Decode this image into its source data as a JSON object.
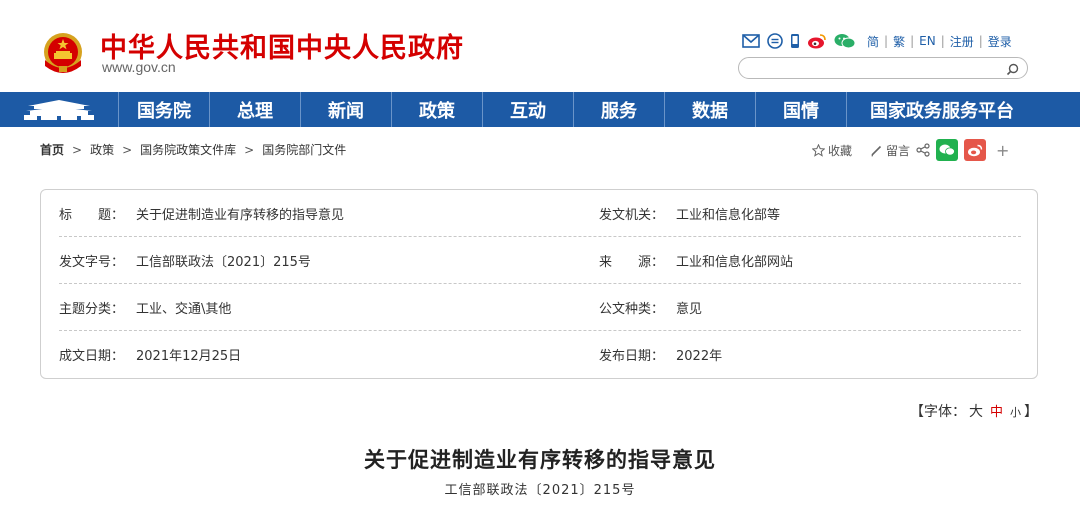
{
  "header": {
    "site_title": "中华人民共和国中央人民政府",
    "site_domain": "www.gov.cn",
    "lang": {
      "simplified": "简",
      "traditional": "繁",
      "english": "EN",
      "register": "注册",
      "login": "登录",
      "separator": "|"
    },
    "search": {
      "placeholder": ""
    }
  },
  "nav": {
    "items": [
      {
        "label": "国务院"
      },
      {
        "label": "总理"
      },
      {
        "label": "新闻"
      },
      {
        "label": "政策"
      },
      {
        "label": "互动"
      },
      {
        "label": "服务"
      },
      {
        "label": "数据"
      },
      {
        "label": "国情"
      },
      {
        "label": "国家政务服务平台"
      }
    ]
  },
  "breadcrumb": {
    "items": [
      "首页",
      "政策",
      "国务院政策文件库",
      "国务院部门文件"
    ],
    "arrow": ">"
  },
  "share": {
    "favorite": "收藏",
    "comment": "留言",
    "plus": "+"
  },
  "info": {
    "title_label": "标　　题：",
    "title_value": "关于促进制造业有序转移的指导意见",
    "issuer_label": "发文机关：",
    "issuer_value": "工业和信息化部等",
    "docno_label": "发文字号：",
    "docno_value": "工信部联政法〔2021〕215号",
    "source_label": "来　　源：",
    "source_value": "工业和信息化部网站",
    "category_label": "主题分类：",
    "category_value": "工业、交通\\其他",
    "doctype_label": "公文种类：",
    "doctype_value": "意见",
    "created_label": "成文日期：",
    "created_value": "2021年12月25日",
    "published_label": "发布日期：",
    "published_value": "2022年"
  },
  "fontsize": {
    "open": "【字体：",
    "large": "大",
    "medium": "中",
    "small": "小",
    "close": "】"
  },
  "article": {
    "title": "关于促进制造业有序转移的指导意见",
    "doc_no": "工信部联政法〔2021〕215号"
  },
  "colors": {
    "brand_red": "#d40000",
    "nav_blue": "#1d5aa5",
    "link_blue": "#1f5fa8"
  }
}
